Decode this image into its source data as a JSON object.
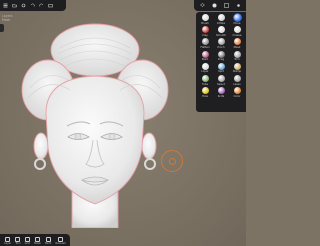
{
  "app": {
    "accent_color": "#3d7cff",
    "cursor_color": "#eb7828",
    "viewport_color": "#7d7364"
  },
  "stats": {
    "line1": "Layers",
    "line2": "Mesh"
  },
  "topbar_left": {
    "icons": [
      "menu-icon",
      "folder-icon",
      "settings-icon",
      "undo-icon",
      "redo-icon",
      "camera-icon"
    ]
  },
  "topbar_right": {
    "icons": [
      "layers-icon",
      "material-icon",
      "scene-icon",
      "sun-icon"
    ]
  },
  "tool_panel": {
    "tools": [
      {
        "label": "Brush",
        "color": "#d9d9d9",
        "icon": "brush-icon",
        "active": false
      },
      {
        "label": "Inflate",
        "color": "#cfcfcf",
        "icon": "inflate-icon",
        "active": false
      },
      {
        "label": "Move",
        "color": "#3d7cff",
        "icon": "move-icon",
        "active": true
      },
      {
        "label": "Clay",
        "color": "#c0392b",
        "icon": "clay-icon",
        "active": false
      },
      {
        "label": "Smooth",
        "color": "#d9d9d9",
        "icon": "smooth-icon",
        "active": false
      },
      {
        "label": "Crease",
        "color": "#d9d9d9",
        "icon": "crease-icon",
        "active": false
      },
      {
        "label": "Flatten",
        "color": "#8a8a8a",
        "icon": "flatten-icon",
        "active": false
      },
      {
        "label": "Pinch",
        "color": "#9a9a9a",
        "icon": "pinch-icon",
        "active": false
      },
      {
        "label": "Mask",
        "color": "#e07b39",
        "icon": "mask-icon",
        "active": false
      },
      {
        "label": "Paint",
        "color": "#b94a7a",
        "icon": "paint-icon",
        "active": false
      },
      {
        "label": "Drag",
        "color": "#6b6b6b",
        "icon": "drag-icon",
        "active": false
      },
      {
        "label": "Trim",
        "color": "#a0a0a0",
        "icon": "trim-icon",
        "active": false
      },
      {
        "label": "Layer",
        "color": "#d9d9d9",
        "icon": "layer-icon",
        "active": false
      },
      {
        "label": "Split",
        "color": "#5a9fd4",
        "icon": "split-icon",
        "active": false
      },
      {
        "label": "Stamp",
        "color": "#c8a65a",
        "icon": "stamp-icon",
        "active": false
      },
      {
        "label": "Tube",
        "color": "#7fb36b",
        "icon": "tube-icon",
        "active": false
      },
      {
        "label": "Select",
        "color": "#a0a0a0",
        "icon": "select-icon",
        "active": false
      },
      {
        "label": "Lasso",
        "color": "#a0a0a0",
        "icon": "lasso-icon",
        "active": false
      },
      {
        "label": "Hole",
        "color": "#e0c000",
        "icon": "hole-icon",
        "active": false
      },
      {
        "label": "Knife",
        "color": "#9b59b6",
        "icon": "knife-icon",
        "active": false
      },
      {
        "label": "Color",
        "color": "#e67e22",
        "icon": "color-icon",
        "active": false
      }
    ]
  },
  "bottombar": {
    "items": [
      {
        "label": "Layer",
        "icon": "layer-icon"
      },
      {
        "label": "Tool",
        "icon": "tool-icon"
      },
      {
        "label": "Grid",
        "icon": "grid-icon"
      },
      {
        "label": "Mask",
        "icon": "mask-icon"
      },
      {
        "label": "Paint",
        "icon": "paint-icon"
      },
      {
        "label": "Remesh",
        "icon": "remesh-icon"
      }
    ]
  }
}
